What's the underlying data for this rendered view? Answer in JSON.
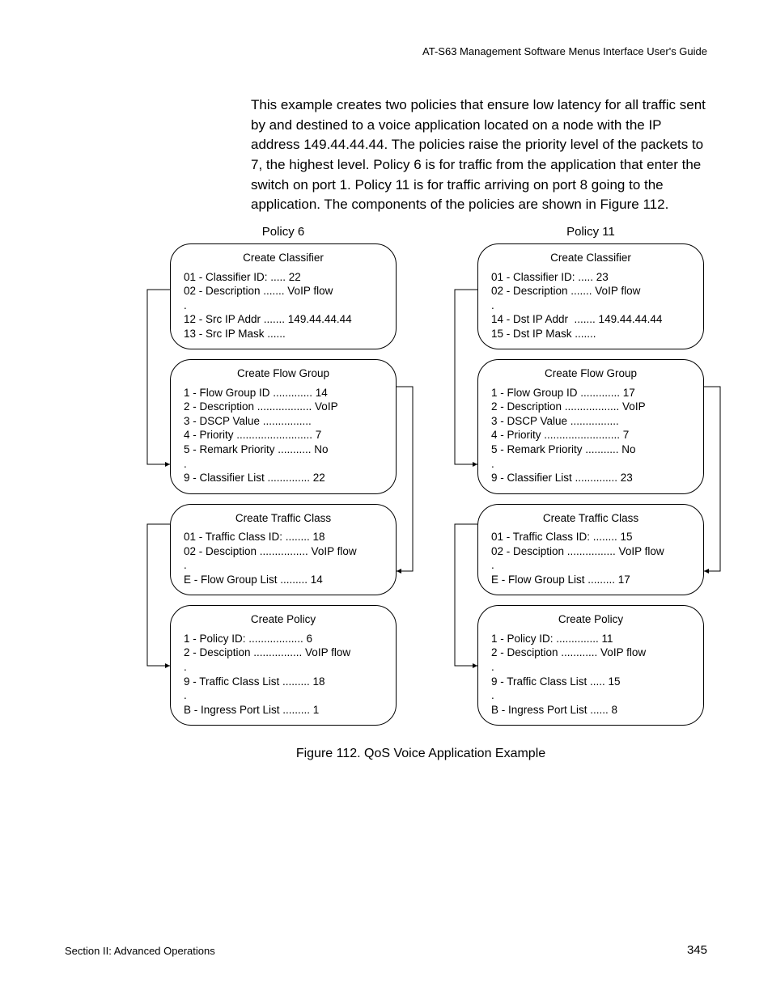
{
  "header": "AT-S63 Management Software Menus Interface User's Guide",
  "paragraph": "This example creates two policies that ensure low latency for all traffic sent by and destined to a voice application located on a node with the IP address 149.44.44.44. The policies raise the priority level of the packets to 7, the highest level. Policy 6 is for traffic from the application that enter the switch on port 1. Policy 11 is for traffic arriving on port 8 going to the application. The components of the policies are shown in Figure 112.",
  "policies": {
    "left": {
      "title": "Policy 6",
      "classifier": {
        "title": "Create Classifier",
        "lines": [
          "01 - Classifier ID: ..... 22",
          "02 - Description ....... VoIP flow",
          ".",
          "12 - Src IP Addr ....... 149.44.44.44",
          "13 - Src IP Mask ......"
        ]
      },
      "flowgroup": {
        "title": "Create Flow Group",
        "lines": [
          "1 - Flow Group ID ............. 14",
          "2 - Description .................. VoIP",
          "3 - DSCP Value ................",
          "4 - Priority ......................... 7",
          "5 - Remark Priority ........... No",
          ".",
          "9 - Classifier List .............. 22"
        ]
      },
      "trafficclass": {
        "title": "Create Traffic Class",
        "lines": [
          "01 - Traffic Class ID: ........ 18",
          "02 - Desciption ................ VoIP flow",
          ".",
          "E - Flow Group List ......... 14"
        ]
      },
      "policy": {
        "title": "Create Policy",
        "lines": [
          "1 - Policy ID: .................. 6",
          "2 - Desciption ................ VoIP flow",
          ".",
          "9 - Traffic Class List ......... 18",
          ".",
          "B - Ingress Port List ......... 1"
        ]
      }
    },
    "right": {
      "title": "Policy 11",
      "classifier": {
        "title": "Create Classifier",
        "lines": [
          "01 - Classifier ID: ..... 23",
          "02 - Description ....... VoIP flow",
          ".",
          "14 - Dst IP Addr  ....... 149.44.44.44",
          "15 - Dst IP Mask ......."
        ]
      },
      "flowgroup": {
        "title": "Create Flow Group",
        "lines": [
          "1 - Flow Group ID ............. 17",
          "2 - Description .................. VoIP",
          "3 - DSCP Value ................",
          "4 - Priority ......................... 7",
          "5 - Remark Priority ........... No",
          ".",
          "9 - Classifier List .............. 23"
        ]
      },
      "trafficclass": {
        "title": "Create Traffic Class",
        "lines": [
          "01 - Traffic Class ID: ........ 15",
          "02 - Desciption ................ VoIP flow",
          ".",
          "E - Flow Group List ......... 17"
        ]
      },
      "policy": {
        "title": "Create Policy",
        "lines": [
          "1 - Policy ID: .............. 11",
          "2 - Desciption ............ VoIP flow",
          ".",
          "9 - Traffic Class List ..... 15",
          ".",
          "B - Ingress Port List ...... 8"
        ]
      }
    }
  },
  "figure_caption": "Figure 112. QoS Voice Application Example",
  "footer_left": "Section II: Advanced Operations",
  "footer_right": "345"
}
